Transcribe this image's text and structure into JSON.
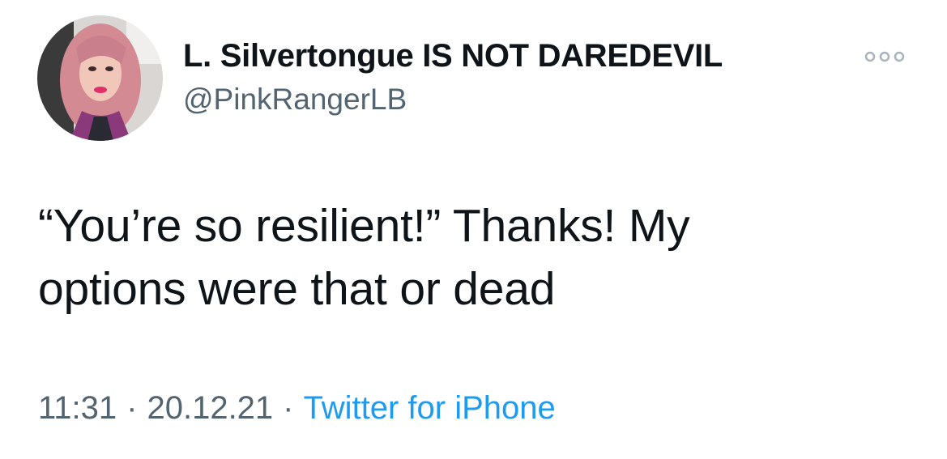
{
  "author": {
    "display_name": "L. Silvertongue IS NOT DAREDEVIL",
    "handle": "@PinkRangerLB"
  },
  "tweet": {
    "text_line1": "“You’re so resilient!” Thanks! My",
    "text_line2": "options were that or dead"
  },
  "meta": {
    "time": "11:31",
    "separator": "·",
    "date": "20.12.21",
    "source": "Twitter for iPhone"
  },
  "icons": {
    "more": "more-options-icon",
    "avatar": "avatar"
  },
  "colors": {
    "text": "#0f1419",
    "secondary": "#536471",
    "link": "#1d9bf0",
    "background": "#ffffff"
  }
}
